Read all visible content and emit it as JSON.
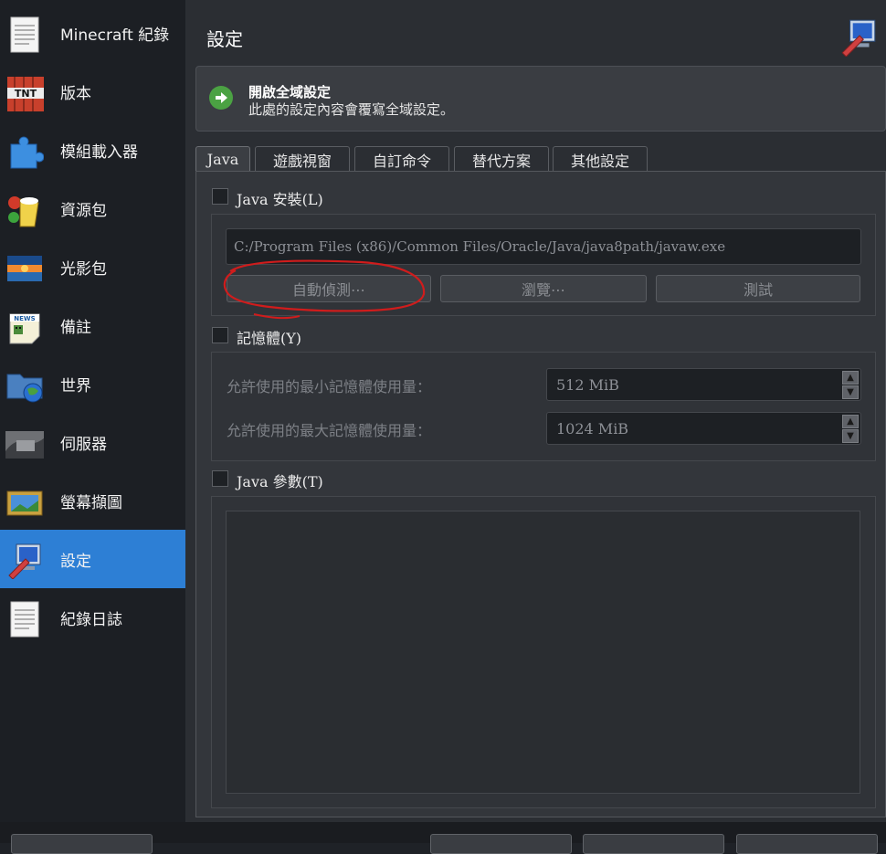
{
  "sidebar": {
    "items": [
      {
        "label": "Minecraft 紀錄",
        "icon": "document-icon"
      },
      {
        "label": "版本",
        "icon": "tnt-block-icon"
      },
      {
        "label": "模組載入器",
        "icon": "puzzle-icon"
      },
      {
        "label": "資源包",
        "icon": "paint-bucket-icon"
      },
      {
        "label": "光影包",
        "icon": "sunset-icon"
      },
      {
        "label": "備註",
        "icon": "news-icon"
      },
      {
        "label": "世界",
        "icon": "globe-folder-icon"
      },
      {
        "label": "伺服器",
        "icon": "server-icon"
      },
      {
        "label": "螢幕擷圖",
        "icon": "screenshot-icon"
      },
      {
        "label": "設定",
        "icon": "settings-computer-icon",
        "active": true
      },
      {
        "label": "紀錄日誌",
        "icon": "log-document-icon"
      }
    ]
  },
  "header": {
    "title": "設定"
  },
  "banner": {
    "title": "開啟全域設定",
    "subtitle": "此處的設定內容會覆寫全域設定。"
  },
  "tabs": [
    "Java",
    "遊戲視窗",
    "自訂命令",
    "替代方案",
    "其他設定"
  ],
  "java_install": {
    "title": "Java 安裝(L)",
    "path": "C:/Program Files (x86)/Common Files/Oracle/Java/java8path/javaw.exe",
    "buttons": [
      "自動偵測⋯",
      "瀏覽⋯",
      "測試"
    ]
  },
  "memory": {
    "title": "記憶體(Y)",
    "min_label": "允許使用的最小記憶體使用量：",
    "min_value": "512 MiB",
    "max_label": "允許使用的最大記憶體使用量：",
    "max_value": "1024 MiB"
  },
  "java_args": {
    "title": "Java 參數(T)"
  },
  "colors": {
    "accent": "#2d7fd5",
    "annotation": "#d01c1c"
  }
}
